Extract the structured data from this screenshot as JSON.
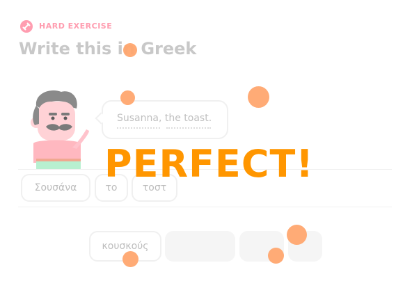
{
  "header": {
    "badge_label": "HARD EXERCISE",
    "title": "Write this in Greek"
  },
  "prompt": {
    "sentence": "Susanna, the toast."
  },
  "answer": {
    "words": [
      "Σουσάνα",
      "το",
      "τοστ"
    ]
  },
  "word_bank": {
    "words": [
      "κουσκούς"
    ]
  },
  "feedback": {
    "message": "PERFECT!"
  },
  "colors": {
    "accent_orange": "#ff9600",
    "confetti": "#ffa76f",
    "badge_pink": "#ff9db0"
  }
}
